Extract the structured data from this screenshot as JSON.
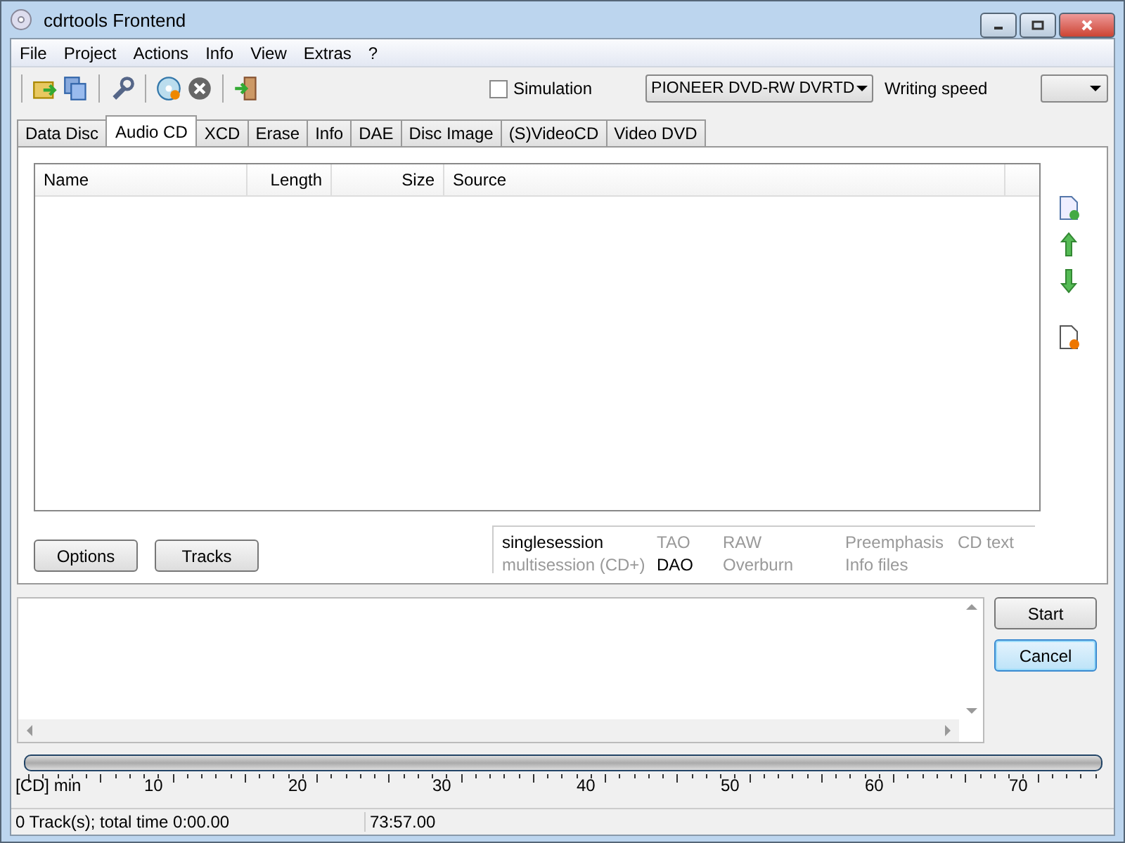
{
  "window": {
    "title": "cdrtools Frontend"
  },
  "menu": [
    "File",
    "Project",
    "Actions",
    "Info",
    "View",
    "Extras",
    "?"
  ],
  "toolbar": {
    "simulation": {
      "label": "Simulation",
      "checked": false
    },
    "drive": {
      "value": "PIONEER DVD-RW DVRTD"
    },
    "speed_label": "Writing speed"
  },
  "tabs": [
    {
      "label": "Data Disc",
      "selected": false
    },
    {
      "label": "Audio CD",
      "selected": true
    },
    {
      "label": "XCD",
      "selected": false
    },
    {
      "label": "Erase",
      "selected": false
    },
    {
      "label": "Info",
      "selected": false
    },
    {
      "label": "DAE",
      "selected": false
    },
    {
      "label": "Disc Image",
      "selected": false
    },
    {
      "label": "(S)VideoCD",
      "selected": false
    },
    {
      "label": "Video DVD",
      "selected": false
    }
  ],
  "table": {
    "columns": [
      "Name",
      "Length",
      "Size",
      "Source"
    ]
  },
  "buttons": [
    "Options",
    "Tracks"
  ],
  "options": [
    [
      {
        "label": "singlesession",
        "active": true
      },
      {
        "label": "multisession (CD+)",
        "active": false
      }
    ],
    [
      {
        "label": "TAO",
        "active": false
      },
      {
        "label": "DAO",
        "active": true
      }
    ],
    [
      {
        "label": "RAW",
        "active": false
      },
      {
        "label": "Overburn",
        "active": false
      }
    ],
    [
      {
        "label": "Preemphasis",
        "active": false
      },
      {
        "label": "Info files",
        "active": false
      }
    ],
    [
      {
        "label": "CD text",
        "active": false
      }
    ]
  ],
  "actions": [
    "Start",
    "Cancel"
  ],
  "capacity": {
    "labels": [
      "[CD] min",
      "10",
      "20",
      "30",
      "40",
      "50",
      "60",
      "70"
    ]
  },
  "status_bar": [
    "0 Track(s); total time 0:00.00",
    "73:57.00"
  ]
}
